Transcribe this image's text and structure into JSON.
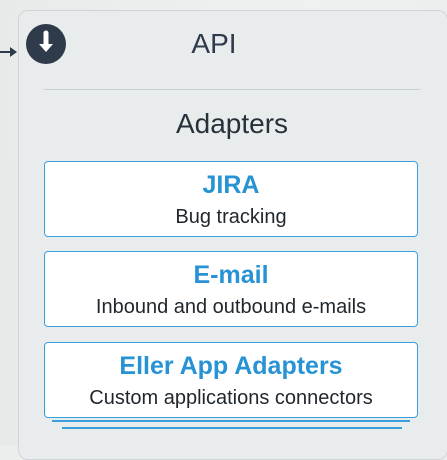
{
  "header": {
    "icon": "arrow-down-circle-icon",
    "title": "API"
  },
  "section": {
    "title": "Adapters"
  },
  "cards": [
    {
      "title": "JIRA",
      "subtitle": "Bug tracking"
    },
    {
      "title": "E-mail",
      "subtitle": "Inbound and outbound e-mails"
    },
    {
      "title": "Eller App Adapters",
      "subtitle": "Custom applications connectors"
    }
  ],
  "colors": {
    "accent": "#3aa0db",
    "title_blue": "#2793d4",
    "dark": "#2f3b4a",
    "panel": "#e9ecec"
  }
}
